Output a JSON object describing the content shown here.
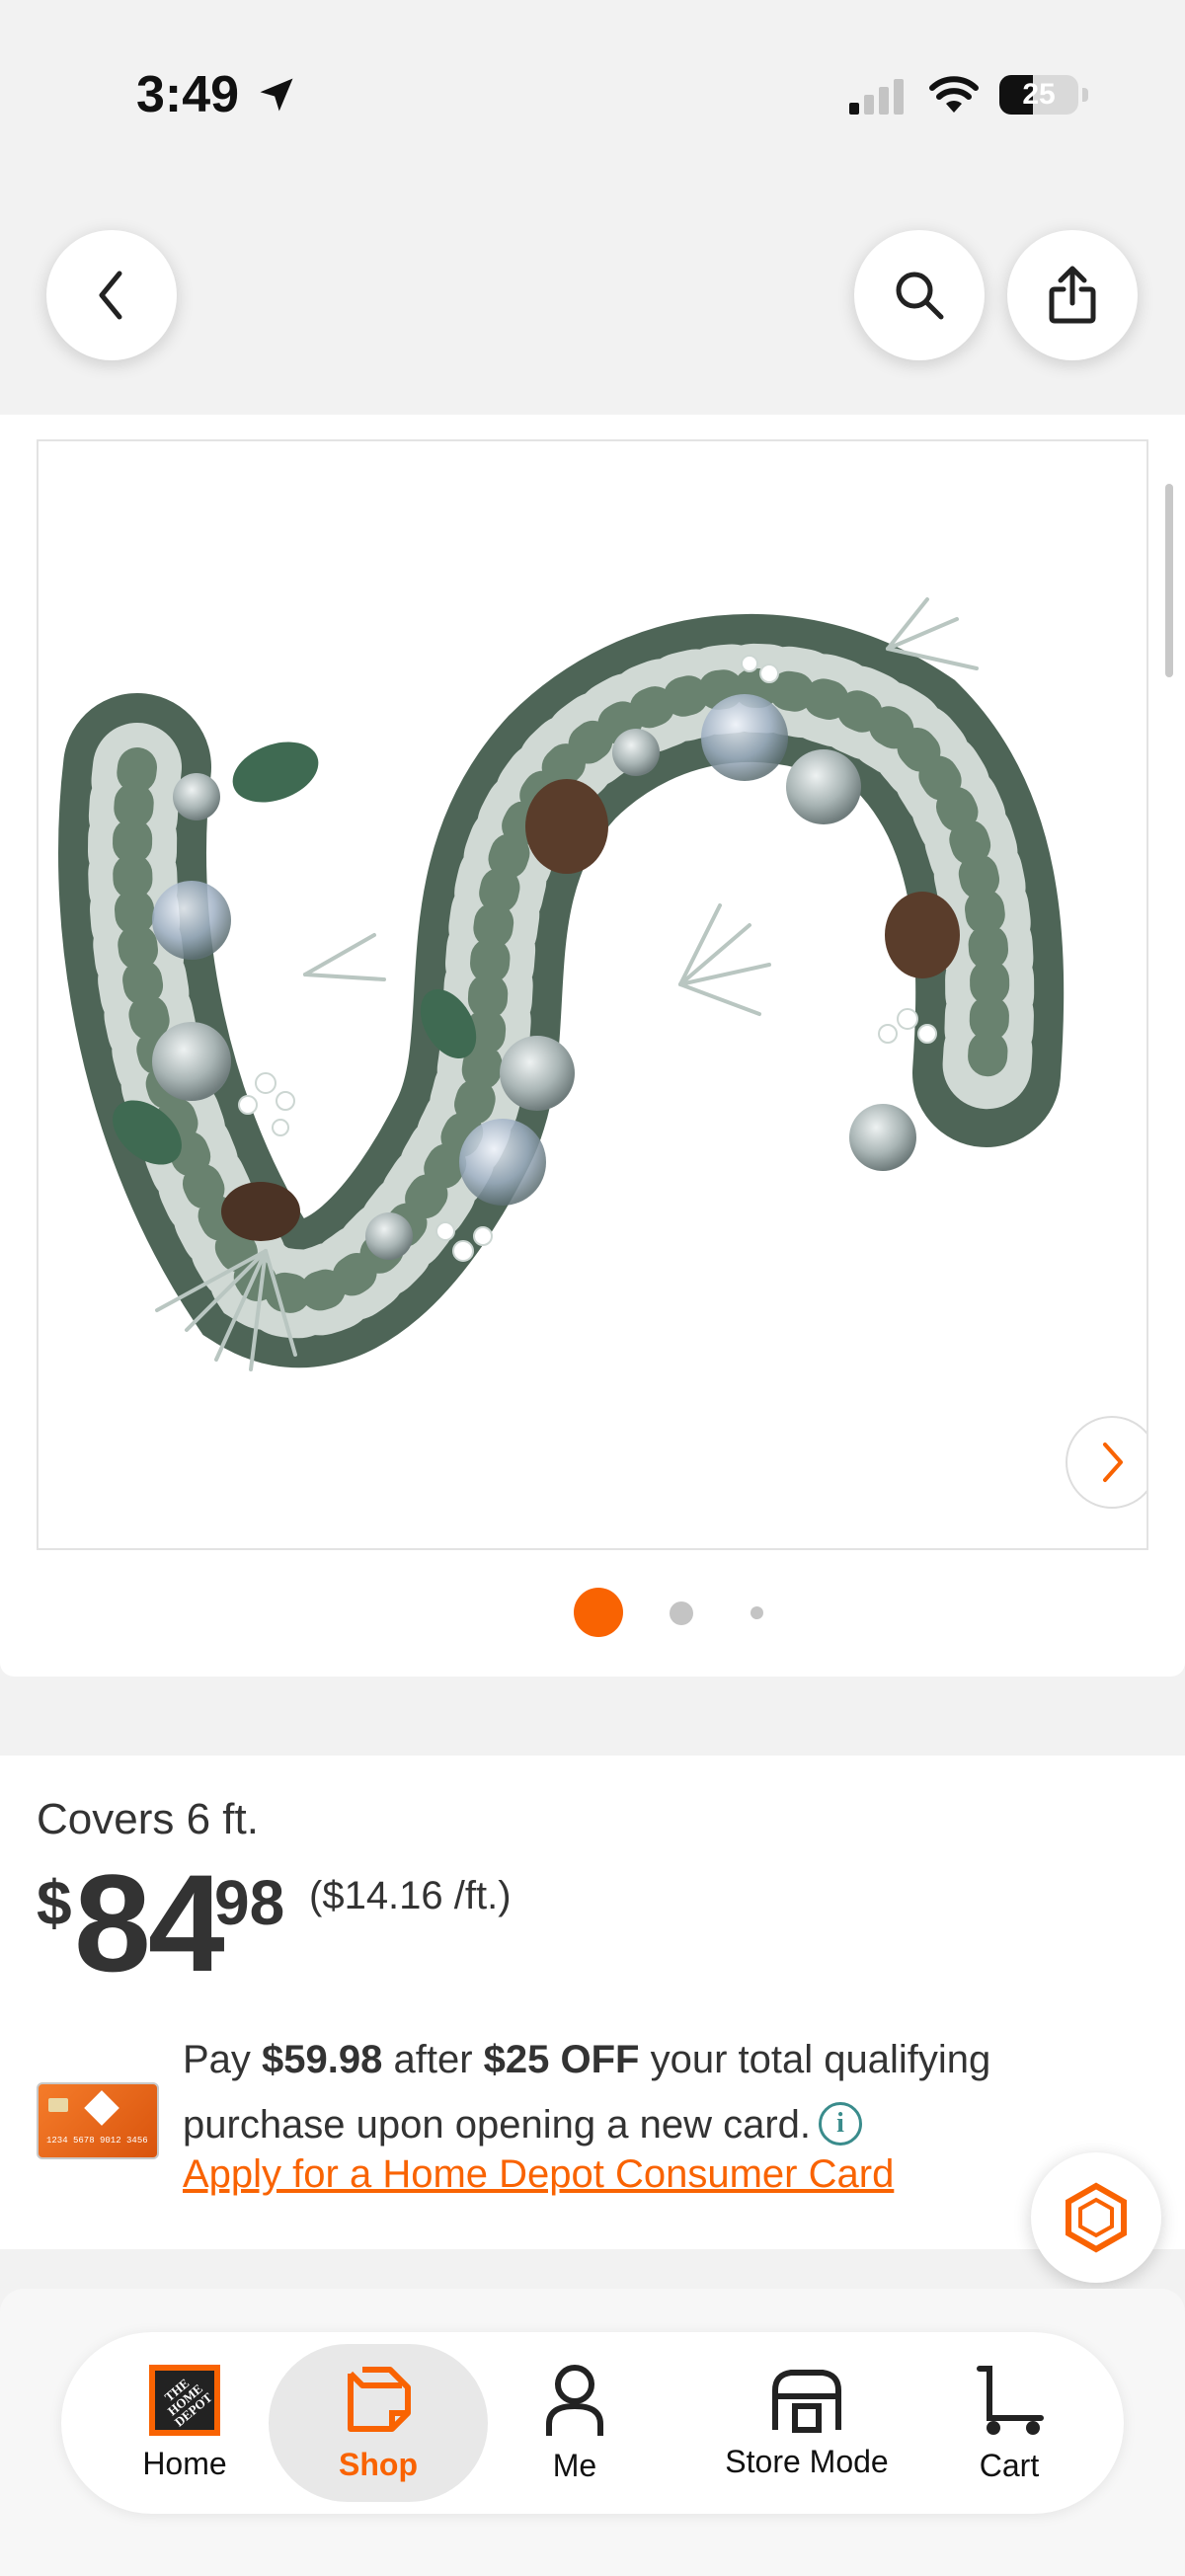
{
  "status_bar": {
    "time": "3:49",
    "battery": "25"
  },
  "header": {
    "back_icon": "chevron-left-icon",
    "search_icon": "search-icon",
    "share_icon": "share-icon"
  },
  "gallery": {
    "image_alt": "Flocked holiday garland with pinecones and silver ornaments",
    "image_count": 3,
    "active_index": 0,
    "next_icon": "chevron-right-icon"
  },
  "product": {
    "coverage": "Covers 6 ft.",
    "price_dollar_sign": "$",
    "price_dollars": "84",
    "price_cents": "98",
    "unit_price": "($14.16 /ft.)"
  },
  "promo": {
    "text_pay": "Pay ",
    "amount_after": "$59.98",
    "text_after": " after ",
    "discount": "$25 OFF",
    "text_rest": " your total qualifying purchase upon opening a new card.",
    "info_icon": "info-icon",
    "apply_link": "Apply for a Home Depot Consumer Card",
    "card_number": "1234 5678 9012 3456"
  },
  "tabs": [
    {
      "label": "Home",
      "icon": "home-depot-logo-icon"
    },
    {
      "label": "Shop",
      "icon": "shop-icon"
    },
    {
      "label": "Me",
      "icon": "person-icon"
    },
    {
      "label": "Store Mode",
      "icon": "store-icon"
    },
    {
      "label": "Cart",
      "icon": "cart-icon"
    }
  ],
  "colors": {
    "accent": "#f96302",
    "info": "#3a8c8c",
    "text": "#333333"
  }
}
